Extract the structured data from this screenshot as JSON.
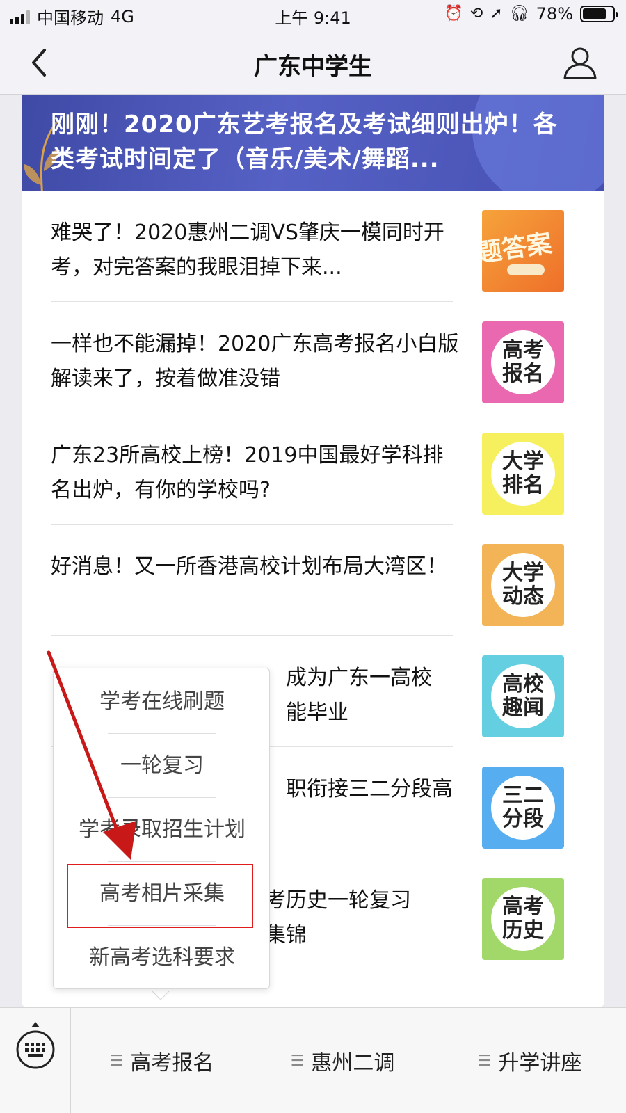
{
  "status_bar": {
    "carrier": "中国移动",
    "network": "4G",
    "time": "上午 9:41",
    "battery_percent": "78%",
    "battery_level": 0.78,
    "icons": [
      "alarm-icon",
      "orientation-lock-icon",
      "location-icon",
      "headphones-icon"
    ]
  },
  "nav": {
    "title": "广东中学生",
    "back_icon": "back-chevron-icon",
    "profile_icon": "user-profile-icon"
  },
  "banner": {
    "title": "刚刚！2020广东艺考报名及考试细则出炉！各类考试时间定了（音乐/美术/舞蹈..."
  },
  "articles": [
    {
      "title": "难哭了！2020惠州二调VS肇庆一模同时开考，对完答案的我眼泪掉下来...",
      "thumb_label": "题答案",
      "thumb_color": "#f0862f"
    },
    {
      "title": "一样也不能漏掉！2020广东高考报名小白版解读来了，按着做准没错",
      "thumb_label": "高考\n报名",
      "thumb_color": "#e968b0"
    },
    {
      "title": "广东23所高校上榜！2019中国最好学科排名出炉，有你的学校吗?",
      "thumb_label": "大学\n排名",
      "thumb_color": "#f6ef5e"
    },
    {
      "title": "好消息！又一所香港高校计划布局大湾区！",
      "thumb_label": "大学\n动态",
      "thumb_color": "#f3b457"
    },
    {
      "title": "成为广东一高校\n能毕业",
      "thumb_label": "高校\n趣闻",
      "thumb_color": "#64cfe0"
    },
    {
      "title": "职衔接三二分段高",
      "thumb_label": "三二\n分段",
      "thumb_color": "#56aef0"
    },
    {
      "title": "考历史一轮复习\n集锦",
      "thumb_label": "高考\n历史",
      "thumb_color": "#a2d86a"
    }
  ],
  "popup_menu": {
    "items": [
      "学考在线刷题",
      "一轮复习",
      "学考录取招生计划",
      "高考相片采集",
      "新高考选科要求"
    ],
    "highlighted": "高考相片采集"
  },
  "bottom_menu": {
    "keyboard_icon": "keyboard-icon",
    "items": [
      "高考报名",
      "惠州二调",
      "升学讲座"
    ]
  },
  "colors": {
    "annotation_red": "#e01d1d",
    "banner_blue": "#4a55b8"
  }
}
